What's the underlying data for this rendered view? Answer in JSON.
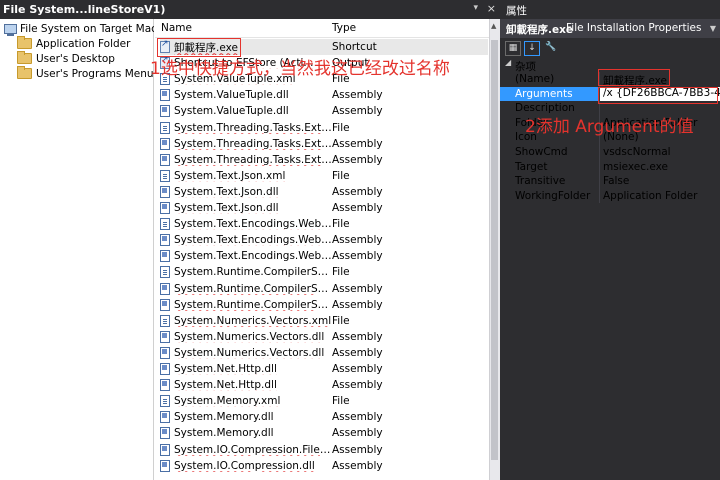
{
  "window": {
    "title": "File System...lineStoreV1)",
    "close_glyph": "×",
    "dropdown_glyph": "▾"
  },
  "tree": {
    "root": "File System on Target Machine",
    "children": [
      "Application Folder",
      "User's Desktop",
      "User's Programs Menu"
    ]
  },
  "list": {
    "headers": {
      "name": "Name",
      "type": "Type"
    },
    "rows": [
      {
        "name": "卸載程序.exe",
        "type": "Shortcut",
        "icon": "shortcut"
      },
      {
        "name": "Shortcut to EFStore (Acti...",
        "type": "Output",
        "icon": "shortcut"
      },
      {
        "name": "System.ValueTuple.xml",
        "type": "File",
        "icon": "file"
      },
      {
        "name": "System.ValueTuple.dll",
        "type": "Assembly",
        "icon": "assembly"
      },
      {
        "name": "System.ValueTuple.dll",
        "type": "Assembly",
        "icon": "assembly"
      },
      {
        "name": "System.Threading.Tasks.Extensi...",
        "type": "File",
        "icon": "file"
      },
      {
        "name": "System.Threading.Tasks.Extensi...",
        "type": "Assembly",
        "icon": "assembly"
      },
      {
        "name": "System.Threading.Tasks.Extensi...",
        "type": "Assembly",
        "icon": "assembly"
      },
      {
        "name": "System.Text.Json.xml",
        "type": "File",
        "icon": "file"
      },
      {
        "name": "System.Text.Json.dll",
        "type": "Assembly",
        "icon": "assembly"
      },
      {
        "name": "System.Text.Json.dll",
        "type": "Assembly",
        "icon": "assembly"
      },
      {
        "name": "System.Text.Encodings.Web.xml",
        "type": "File",
        "icon": "file"
      },
      {
        "name": "System.Text.Encodings.Web.dll",
        "type": "Assembly",
        "icon": "assembly"
      },
      {
        "name": "System.Text.Encodings.Web.dll",
        "type": "Assembly",
        "icon": "assembly"
      },
      {
        "name": "System.Runtime.CompilerService...",
        "type": "File",
        "icon": "file"
      },
      {
        "name": "System.Runtime.CompilerService...",
        "type": "Assembly",
        "icon": "assembly"
      },
      {
        "name": "System.Runtime.CompilerService...",
        "type": "Assembly",
        "icon": "assembly"
      },
      {
        "name": "System.Numerics.Vectors.xml",
        "type": "File",
        "icon": "file"
      },
      {
        "name": "System.Numerics.Vectors.dll",
        "type": "Assembly",
        "icon": "assembly"
      },
      {
        "name": "System.Numerics.Vectors.dll",
        "type": "Assembly",
        "icon": "assembly"
      },
      {
        "name": "System.Net.Http.dll",
        "type": "Assembly",
        "icon": "assembly"
      },
      {
        "name": "System.Net.Http.dll",
        "type": "Assembly",
        "icon": "assembly"
      },
      {
        "name": "System.Memory.xml",
        "type": "File",
        "icon": "file"
      },
      {
        "name": "System.Memory.dll",
        "type": "Assembly",
        "icon": "assembly"
      },
      {
        "name": "System.Memory.dll",
        "type": "Assembly",
        "icon": "assembly"
      },
      {
        "name": "System.IO.Compression.FileSyst...",
        "type": "Assembly",
        "icon": "assembly"
      },
      {
        "name": "System.IO.Compression.dll",
        "type": "Assembly",
        "icon": "assembly"
      }
    ]
  },
  "properties": {
    "title": "属性",
    "object_name": "卸載程序.exe",
    "object_kind": "File Installation Properties",
    "toolbar": [
      "categorized-icon",
      "alphabetical-icon",
      "property-pages-icon"
    ],
    "category": "杂项",
    "rows": [
      {
        "name": "(Name)",
        "value": "卸載程序.exe"
      },
      {
        "name": "Arguments",
        "value": "/x {DF26BBCA-7BB3-4568-"
      },
      {
        "name": "Description",
        "value": ""
      },
      {
        "name": "Folder",
        "value": "Application Folder"
      },
      {
        "name": "Icon",
        "value": "(None)"
      },
      {
        "name": "ShowCmd",
        "value": "vsdscNormal"
      },
      {
        "name": "Target",
        "value": "msiexec.exe"
      },
      {
        "name": "Transitive",
        "value": "False"
      },
      {
        "name": "WorkingFolder",
        "value": "Application Folder"
      }
    ]
  },
  "annotations": {
    "step1": "1选中快捷方式，当然我这已经改过名称",
    "step2": "2添加 Argument的值"
  },
  "colors": {
    "annotation": "#e4332d",
    "selection": "#3399ff",
    "dark_panel": "#2d2d30"
  }
}
